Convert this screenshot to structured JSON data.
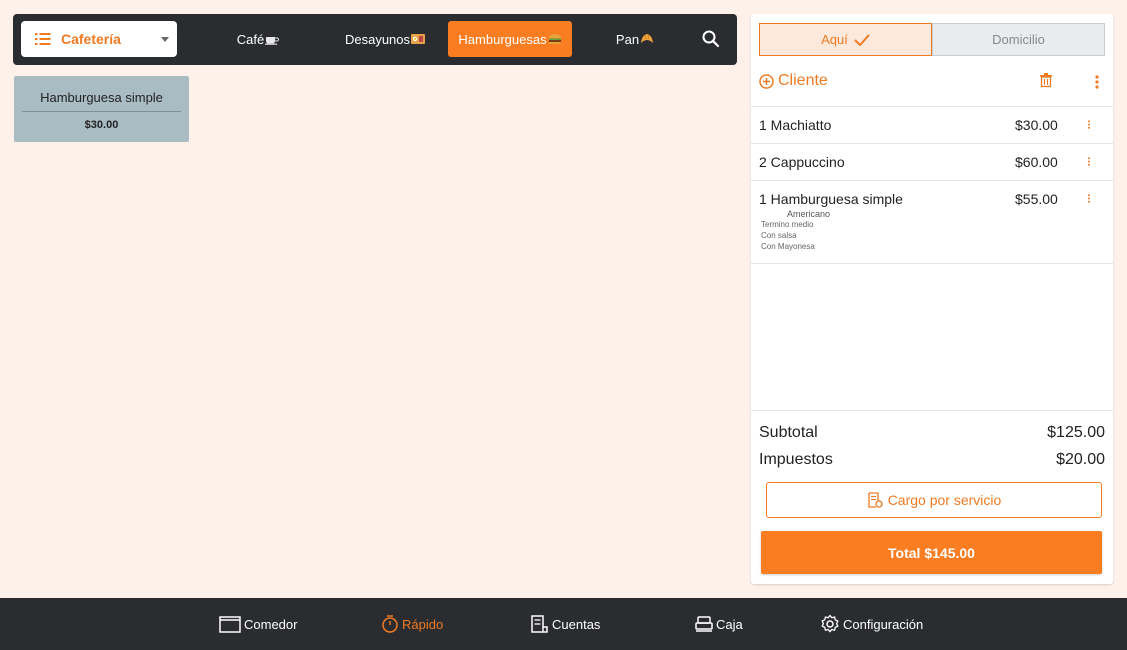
{
  "topbar": {
    "menu_title": "Cafetería",
    "categories": [
      {
        "label": "Café",
        "emoji": "coffee-emoji"
      },
      {
        "label": "Desayunos",
        "emoji": "breakfast-emoji"
      },
      {
        "label": "Hamburguesas",
        "emoji": "burger-emoji",
        "active": true
      },
      {
        "label": "Pan",
        "emoji": "croissant-emoji"
      }
    ],
    "search_icon": "search-icon"
  },
  "products": [
    {
      "name": "Hamburguesa simple",
      "price": "$30.00"
    }
  ],
  "order": {
    "mode_tabs": [
      {
        "label": "Aquí",
        "selected": true
      },
      {
        "label": "Domicilio",
        "selected": false
      }
    ],
    "client_label": "Cliente",
    "items": [
      {
        "line": "1 Machiatto",
        "price": "$30.00",
        "modifiers_main": "",
        "modifiers": []
      },
      {
        "line": "2 Cappuccino",
        "price": "$60.00",
        "modifiers_main": "",
        "modifiers": []
      },
      {
        "line": "1 Hamburguesa simple",
        "price": "$55.00",
        "modifiers_main": "Americano",
        "modifiers": [
          "Termino medio",
          "Con salsa",
          "Con Mayonesa"
        ]
      }
    ],
    "subtotal_label": "Subtotal",
    "subtotal_value": "$125.00",
    "taxes_label": "Impuestos",
    "taxes_value": "$20.00",
    "service_label": "Cargo por servicio",
    "total_label": "Total $145.00"
  },
  "bottomnav": [
    {
      "label": "Comedor",
      "icon": "table-icon"
    },
    {
      "label": "Rápido",
      "icon": "stopwatch-icon",
      "active": true
    },
    {
      "label": "Cuentas",
      "icon": "receipt-icon"
    },
    {
      "label": "Caja",
      "icon": "cash-register-icon"
    },
    {
      "label": "Configuración",
      "icon": "gear-icon"
    }
  ],
  "colors": {
    "accent": "#fa7d22",
    "dark_bar": "#2a2c30",
    "background": "#fdf1ea",
    "product_card": "#a9bcc4"
  }
}
